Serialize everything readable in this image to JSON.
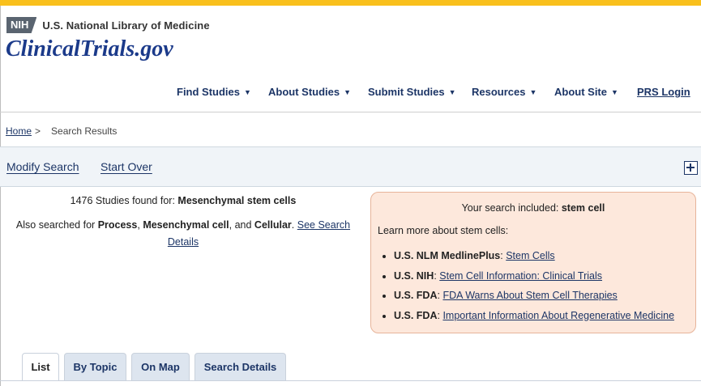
{
  "header": {
    "nih_badge": "NIH",
    "library_name": "U.S. National Library of Medicine",
    "site_title": "ClinicalTrials.gov"
  },
  "nav": {
    "items": [
      {
        "label": "Find Studies",
        "caret": "▼"
      },
      {
        "label": "About Studies",
        "caret": "▼"
      },
      {
        "label": "Submit Studies",
        "caret": "▼"
      },
      {
        "label": "Resources",
        "caret": "▼"
      },
      {
        "label": "About Site",
        "caret": "▼"
      }
    ],
    "prs_login": "PRS Login"
  },
  "breadcrumb": {
    "home": "Home",
    "separator": ">",
    "current": "Search Results"
  },
  "actions": {
    "modify_search": "Modify Search",
    "start_over": "Start Over",
    "expand_icon": "plus-square-icon"
  },
  "results": {
    "count_text": "1476 Studies found for:",
    "query": "Mesenchymal stem cells",
    "also_prefix": "Also searched for",
    "term1": "Process",
    "comma": ",",
    "term2": "Mesenchymal cell",
    "and_text": ", and",
    "term3": "Cellular",
    "period": ".",
    "details_link": "See Search Details"
  },
  "infobox": {
    "included_prefix": "Your search included:",
    "included_term": "stem cell",
    "learn_more": "Learn more about stem cells:",
    "links": [
      {
        "source": "U.S. NLM MedlinePlus",
        "link": "Stem Cells"
      },
      {
        "source": "U.S. NIH",
        "link": "Stem Cell Information: Clinical Trials"
      },
      {
        "source": "U.S. FDA",
        "link": "FDA Warns About Stem Cell Therapies"
      },
      {
        "source": "U.S. FDA",
        "link": "Important Information About Regenerative Medicine"
      }
    ],
    "colors": {
      "background": "#fde8dc",
      "border": "#e7b49a"
    }
  },
  "tabs": [
    {
      "label": "List",
      "active": true
    },
    {
      "label": "By Topic",
      "active": false
    },
    {
      "label": "On Map",
      "active": false
    },
    {
      "label": "Search Details",
      "active": false
    }
  ],
  "theme": {
    "accent_bar": "#f9c01c",
    "link_color": "#1c3566",
    "title_color": "#1b3a8a"
  }
}
